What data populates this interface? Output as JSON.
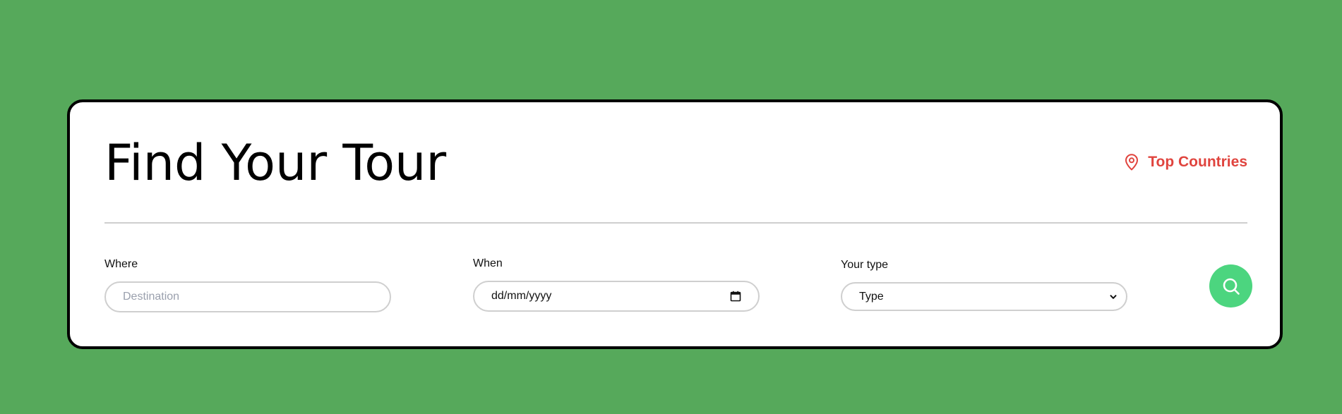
{
  "page": {
    "background_color": "#56a95b"
  },
  "card": {
    "title": "Find Your Tour",
    "top_link": {
      "label": "Top Countries",
      "icon": "map-pin-icon",
      "color": "#e0443e"
    }
  },
  "form": {
    "where": {
      "label": "Where",
      "placeholder": "Destination",
      "value": ""
    },
    "when": {
      "label": "When",
      "value": "dd/mm/yyyy",
      "icon": "calendar-icon"
    },
    "type": {
      "label": "Your type",
      "selected": "Type",
      "icon": "chevron-down-icon"
    },
    "search_button": {
      "icon": "search-icon",
      "color": "#4cd57f"
    }
  }
}
